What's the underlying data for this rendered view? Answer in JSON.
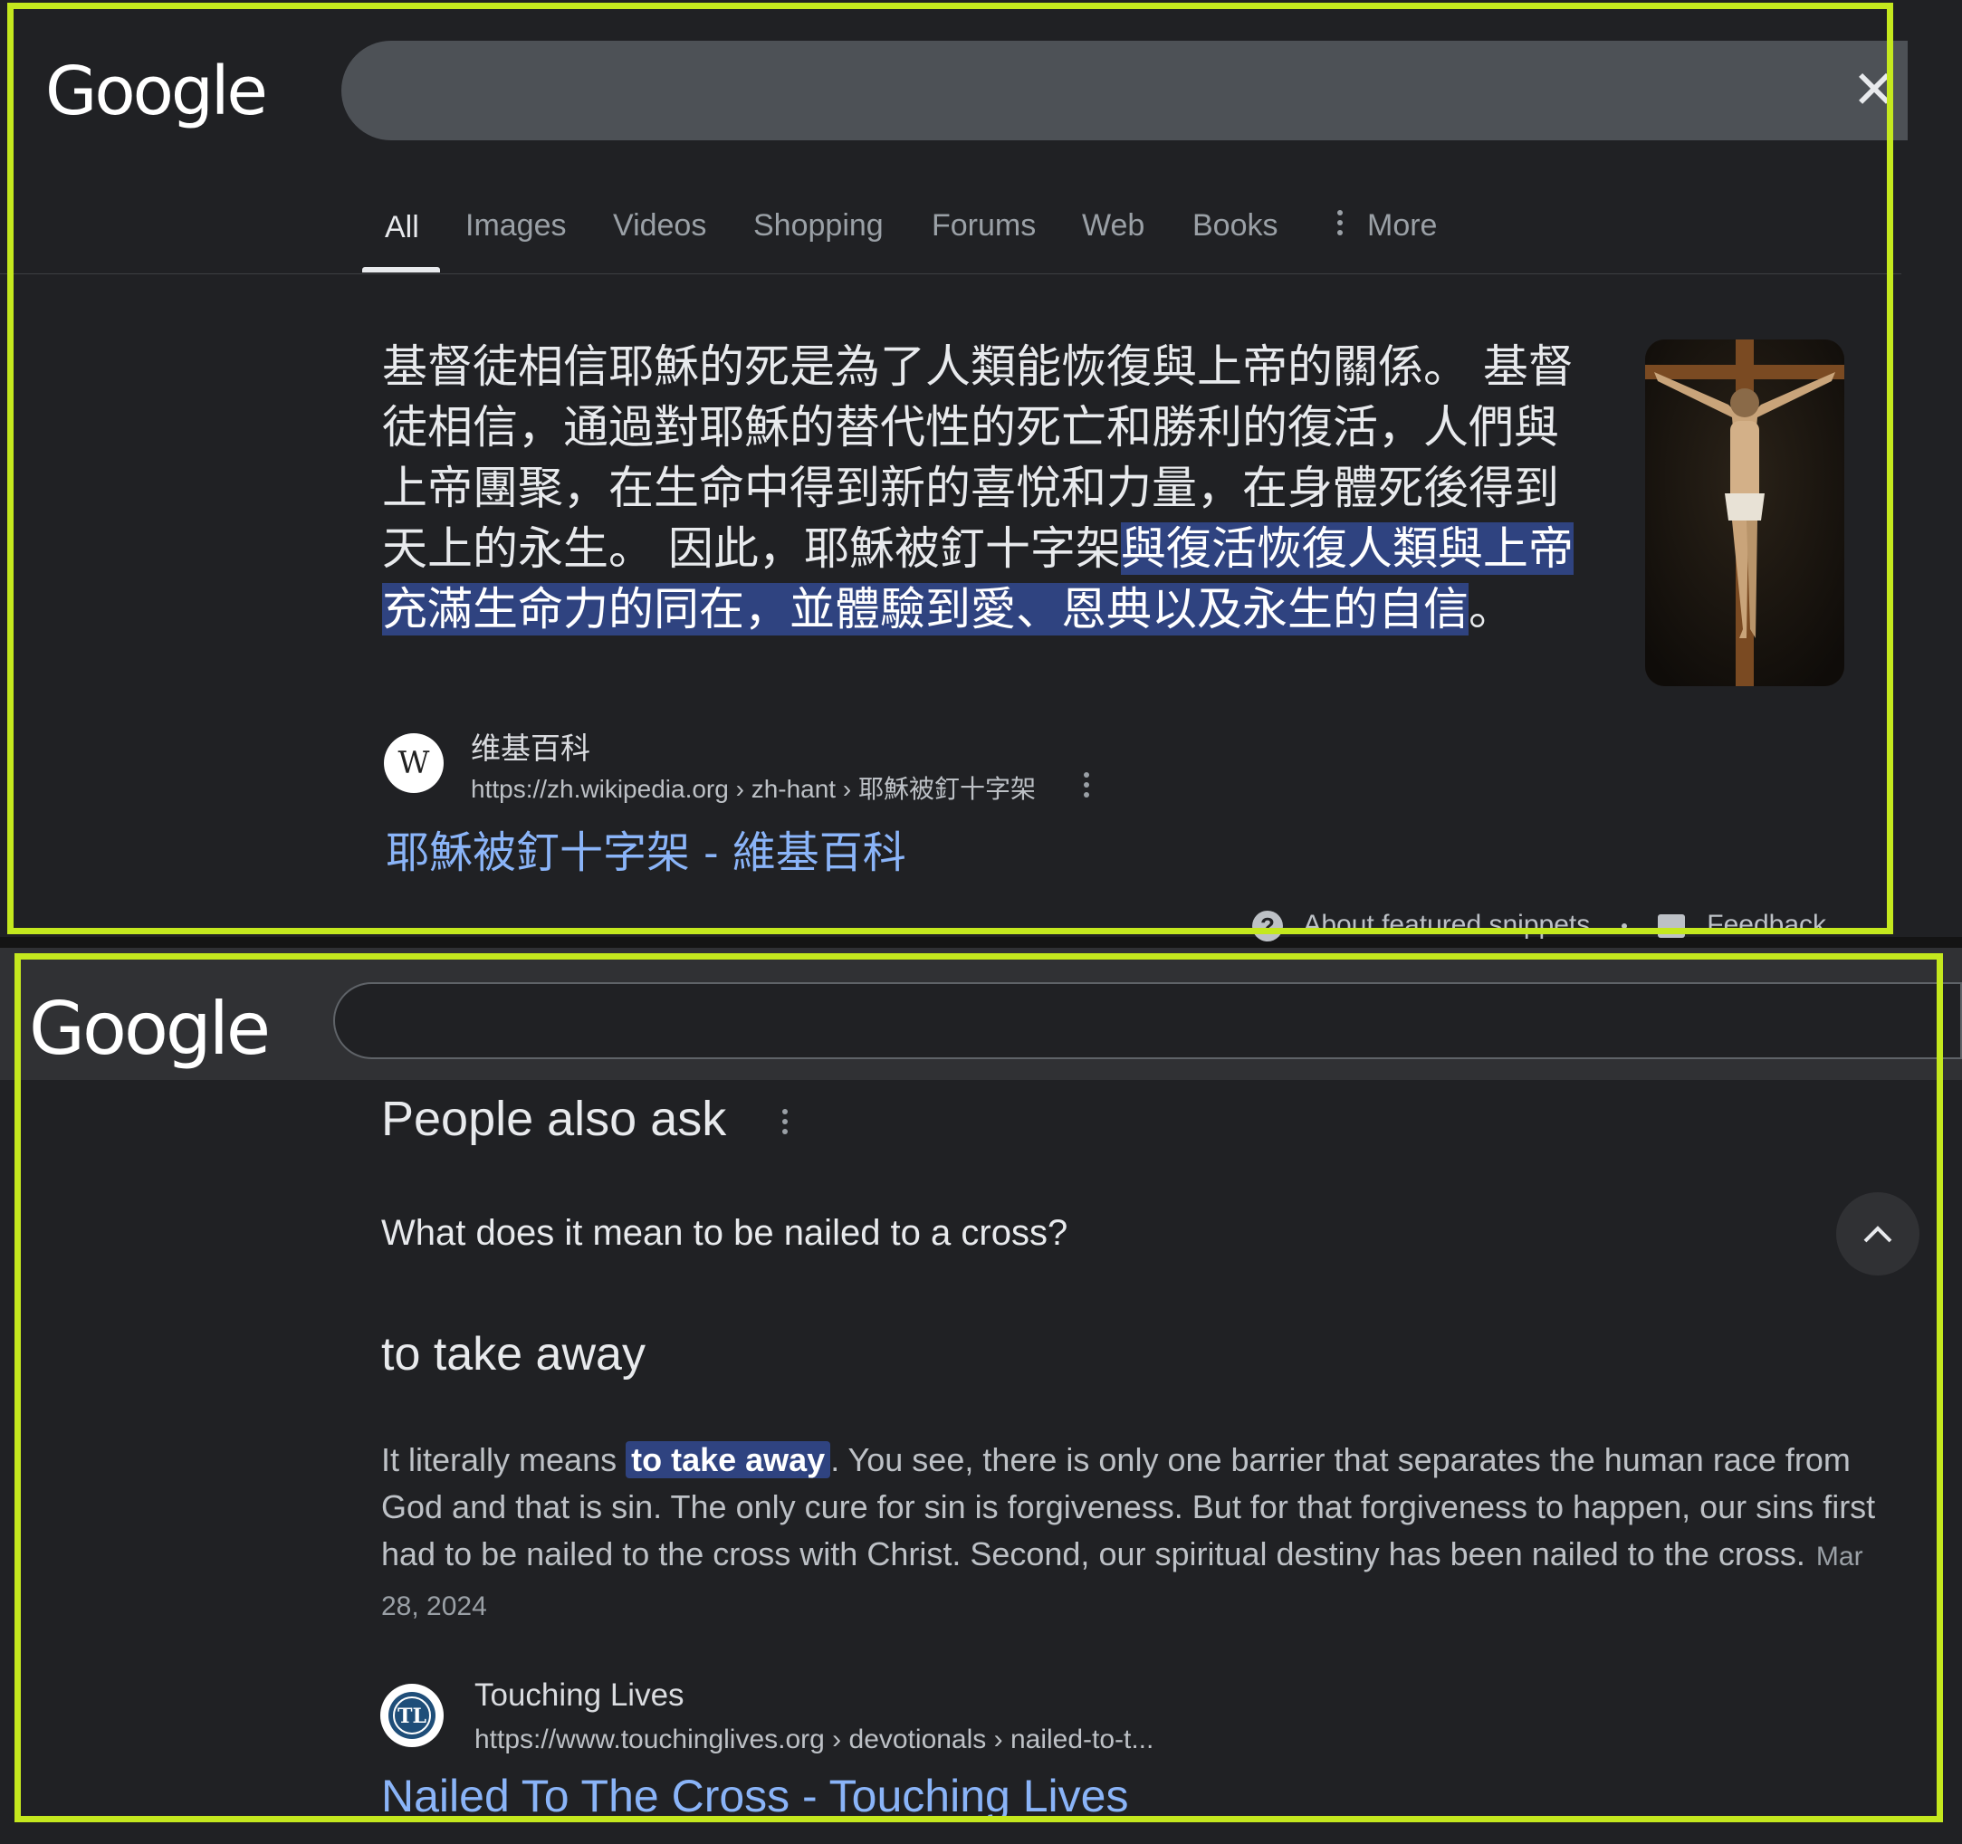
{
  "top": {
    "logo": "Google",
    "tabs": [
      "All",
      "Images",
      "Videos",
      "Shopping",
      "Forums",
      "Web",
      "Books",
      "More"
    ],
    "snippet": {
      "plain": "基督徒相信耶穌的死是為了人類能恢復與上帝的關係。 基督徒相信，通過對耶穌的替代性的死亡和勝利的復活，人們與上帝團聚，在生命中得到新的喜悅和力量，在身體死後得到天上的永生。 因此，耶穌被釘十字架",
      "highlight": "與復活恢復人類與上帝充滿生命力的同在，並體驗到愛、恩典以及永生的自信",
      "end": "。"
    },
    "source": {
      "favicon_letter": "W",
      "site": "维基百科",
      "url": "https://zh.wikipedia.org › zh-hant › 耶穌被釘十字架",
      "title": "耶穌被釘十字架 - 維基百科"
    },
    "footer": {
      "about": "About featured snippets",
      "feedback": "Feedback"
    }
  },
  "bottom": {
    "logo": "Google",
    "paa_title": "People also ask",
    "question": "What does it mean to be nailed to a cross?",
    "answer_heading": "to take away",
    "answer": {
      "before": "It literally means ",
      "highlight": "to take away",
      "after": ". You see, there is only one barrier that separates the human race from God and that is sin. The only cure for sin is forgiveness. But for that forgiveness to happen, our sins first had to be nailed to the cross with Christ. Second, our spiritual destiny has been nailed to the cross.",
      "date": "Mar 28, 2024"
    },
    "source": {
      "favicon_letters": "TL",
      "site": "Touching Lives",
      "url": "https://www.touchinglives.org › devotionals › nailed-to-t...",
      "title": "Nailed To The Cross - Touching Lives"
    }
  },
  "colors": {
    "background": "#202124",
    "outline": "#c4e81e",
    "link": "#8ab4f8",
    "highlight": "#2f4380"
  }
}
